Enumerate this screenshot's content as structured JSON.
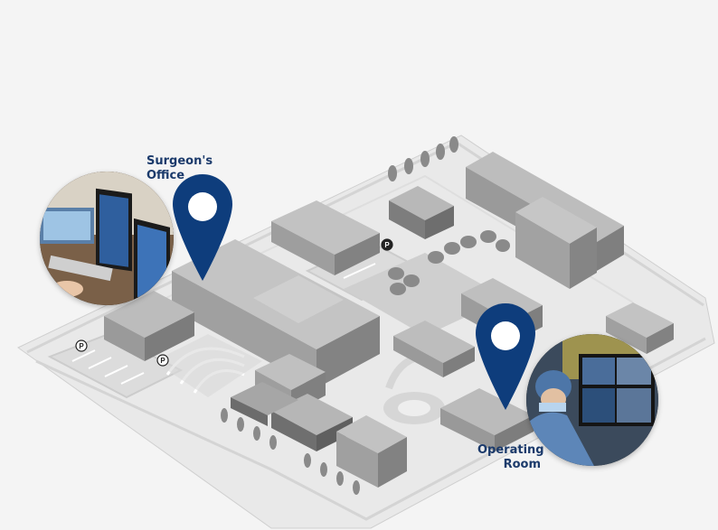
{
  "locations": {
    "surgeons_office": {
      "label_line1": "Surgeon's",
      "label_line2": "Office",
      "icon": "map-pin-icon"
    },
    "operating_room": {
      "label_line1": "Operating",
      "label_line2": "Room",
      "icon": "map-pin-icon"
    }
  },
  "parking": {
    "symbol": "P",
    "icon": "parking-icon"
  },
  "colors": {
    "pin": "#0e3d7c",
    "label": "#1b3a6b",
    "ground": "#f4f4f4",
    "road": "#e6e6e6",
    "building_top": "#bdbdbd",
    "building_side": "#8e8e8e",
    "tree": "#8a8a8a"
  }
}
